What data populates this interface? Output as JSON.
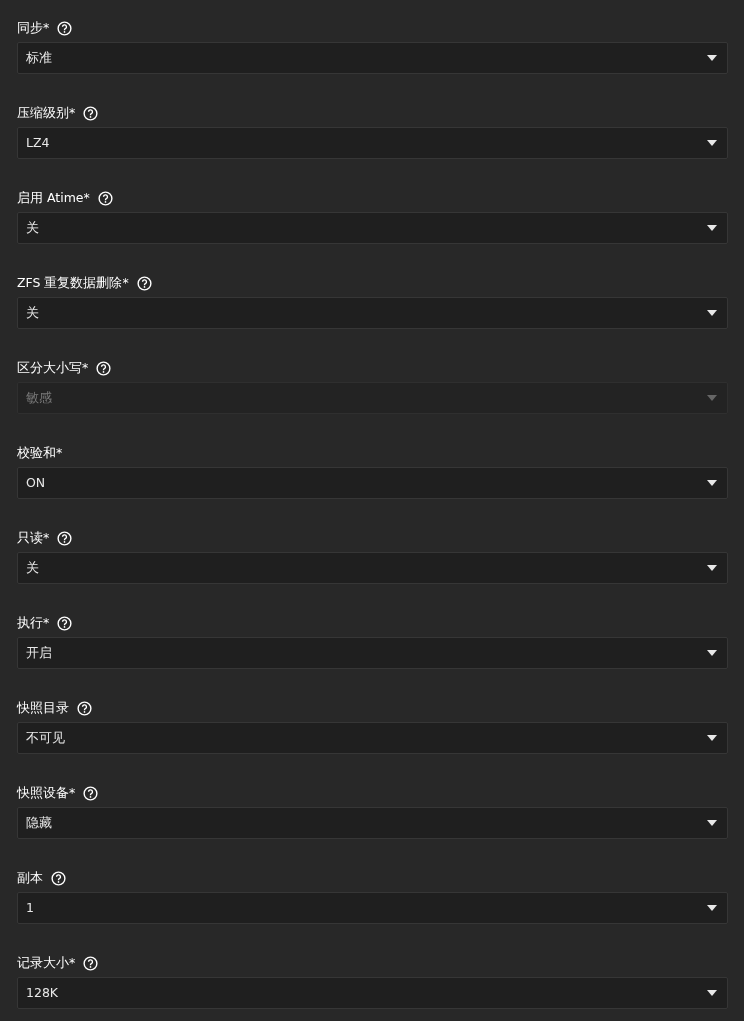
{
  "fields": [
    {
      "label": "同步*",
      "help": true,
      "value": "标准",
      "disabled": false
    },
    {
      "label": "压缩级别*",
      "help": true,
      "value": "LZ4",
      "disabled": false
    },
    {
      "label": "启用 Atime*",
      "help": true,
      "value": "关",
      "disabled": false
    },
    {
      "label": "ZFS 重复数据删除*",
      "help": true,
      "value": "关",
      "disabled": false
    },
    {
      "label": "区分大小写*",
      "help": true,
      "value": "敏感",
      "disabled": true
    },
    {
      "label": "校验和*",
      "help": false,
      "value": "ON",
      "disabled": false
    },
    {
      "label": "只读*",
      "help": true,
      "value": "关",
      "disabled": false
    },
    {
      "label": "执行*",
      "help": true,
      "value": "开启",
      "disabled": false
    },
    {
      "label": "快照目录",
      "help": true,
      "value": "不可见",
      "disabled": false
    },
    {
      "label": "快照设备*",
      "help": true,
      "value": "隐藏",
      "disabled": false
    },
    {
      "label": "副本",
      "help": true,
      "value": "1",
      "disabled": false
    },
    {
      "label": "记录大小*",
      "help": true,
      "value": "128K",
      "disabled": false
    }
  ]
}
